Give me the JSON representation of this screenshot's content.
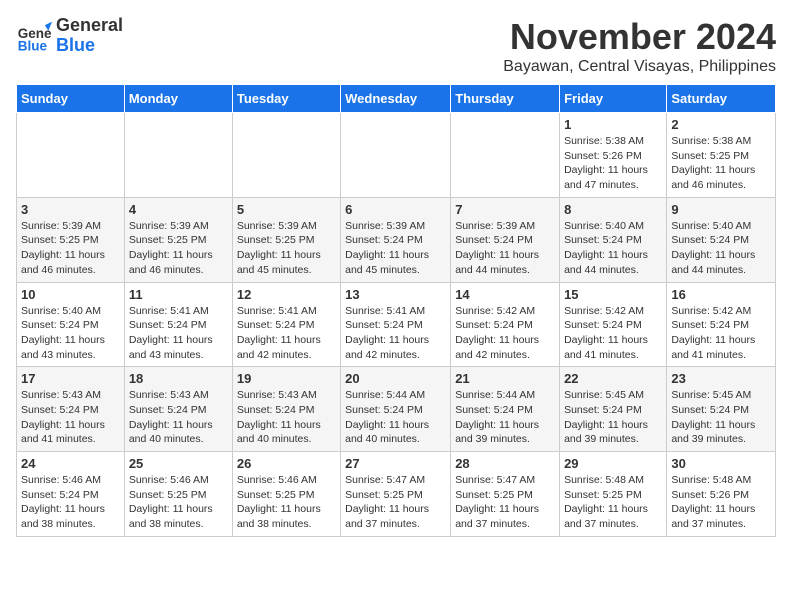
{
  "logo": {
    "line1": "General",
    "line2": "Blue"
  },
  "title": "November 2024",
  "location": "Bayawan, Central Visayas, Philippines",
  "weekdays": [
    "Sunday",
    "Monday",
    "Tuesday",
    "Wednesday",
    "Thursday",
    "Friday",
    "Saturday"
  ],
  "weeks": [
    [
      {
        "day": "",
        "info": ""
      },
      {
        "day": "",
        "info": ""
      },
      {
        "day": "",
        "info": ""
      },
      {
        "day": "",
        "info": ""
      },
      {
        "day": "",
        "info": ""
      },
      {
        "day": "1",
        "info": "Sunrise: 5:38 AM\nSunset: 5:26 PM\nDaylight: 11 hours and 47 minutes."
      },
      {
        "day": "2",
        "info": "Sunrise: 5:38 AM\nSunset: 5:25 PM\nDaylight: 11 hours and 46 minutes."
      }
    ],
    [
      {
        "day": "3",
        "info": "Sunrise: 5:39 AM\nSunset: 5:25 PM\nDaylight: 11 hours and 46 minutes."
      },
      {
        "day": "4",
        "info": "Sunrise: 5:39 AM\nSunset: 5:25 PM\nDaylight: 11 hours and 46 minutes."
      },
      {
        "day": "5",
        "info": "Sunrise: 5:39 AM\nSunset: 5:25 PM\nDaylight: 11 hours and 45 minutes."
      },
      {
        "day": "6",
        "info": "Sunrise: 5:39 AM\nSunset: 5:24 PM\nDaylight: 11 hours and 45 minutes."
      },
      {
        "day": "7",
        "info": "Sunrise: 5:39 AM\nSunset: 5:24 PM\nDaylight: 11 hours and 44 minutes."
      },
      {
        "day": "8",
        "info": "Sunrise: 5:40 AM\nSunset: 5:24 PM\nDaylight: 11 hours and 44 minutes."
      },
      {
        "day": "9",
        "info": "Sunrise: 5:40 AM\nSunset: 5:24 PM\nDaylight: 11 hours and 44 minutes."
      }
    ],
    [
      {
        "day": "10",
        "info": "Sunrise: 5:40 AM\nSunset: 5:24 PM\nDaylight: 11 hours and 43 minutes."
      },
      {
        "day": "11",
        "info": "Sunrise: 5:41 AM\nSunset: 5:24 PM\nDaylight: 11 hours and 43 minutes."
      },
      {
        "day": "12",
        "info": "Sunrise: 5:41 AM\nSunset: 5:24 PM\nDaylight: 11 hours and 42 minutes."
      },
      {
        "day": "13",
        "info": "Sunrise: 5:41 AM\nSunset: 5:24 PM\nDaylight: 11 hours and 42 minutes."
      },
      {
        "day": "14",
        "info": "Sunrise: 5:42 AM\nSunset: 5:24 PM\nDaylight: 11 hours and 42 minutes."
      },
      {
        "day": "15",
        "info": "Sunrise: 5:42 AM\nSunset: 5:24 PM\nDaylight: 11 hours and 41 minutes."
      },
      {
        "day": "16",
        "info": "Sunrise: 5:42 AM\nSunset: 5:24 PM\nDaylight: 11 hours and 41 minutes."
      }
    ],
    [
      {
        "day": "17",
        "info": "Sunrise: 5:43 AM\nSunset: 5:24 PM\nDaylight: 11 hours and 41 minutes."
      },
      {
        "day": "18",
        "info": "Sunrise: 5:43 AM\nSunset: 5:24 PM\nDaylight: 11 hours and 40 minutes."
      },
      {
        "day": "19",
        "info": "Sunrise: 5:43 AM\nSunset: 5:24 PM\nDaylight: 11 hours and 40 minutes."
      },
      {
        "day": "20",
        "info": "Sunrise: 5:44 AM\nSunset: 5:24 PM\nDaylight: 11 hours and 40 minutes."
      },
      {
        "day": "21",
        "info": "Sunrise: 5:44 AM\nSunset: 5:24 PM\nDaylight: 11 hours and 39 minutes."
      },
      {
        "day": "22",
        "info": "Sunrise: 5:45 AM\nSunset: 5:24 PM\nDaylight: 11 hours and 39 minutes."
      },
      {
        "day": "23",
        "info": "Sunrise: 5:45 AM\nSunset: 5:24 PM\nDaylight: 11 hours and 39 minutes."
      }
    ],
    [
      {
        "day": "24",
        "info": "Sunrise: 5:46 AM\nSunset: 5:24 PM\nDaylight: 11 hours and 38 minutes."
      },
      {
        "day": "25",
        "info": "Sunrise: 5:46 AM\nSunset: 5:25 PM\nDaylight: 11 hours and 38 minutes."
      },
      {
        "day": "26",
        "info": "Sunrise: 5:46 AM\nSunset: 5:25 PM\nDaylight: 11 hours and 38 minutes."
      },
      {
        "day": "27",
        "info": "Sunrise: 5:47 AM\nSunset: 5:25 PM\nDaylight: 11 hours and 37 minutes."
      },
      {
        "day": "28",
        "info": "Sunrise: 5:47 AM\nSunset: 5:25 PM\nDaylight: 11 hours and 37 minutes."
      },
      {
        "day": "29",
        "info": "Sunrise: 5:48 AM\nSunset: 5:25 PM\nDaylight: 11 hours and 37 minutes."
      },
      {
        "day": "30",
        "info": "Sunrise: 5:48 AM\nSunset: 5:26 PM\nDaylight: 11 hours and 37 minutes."
      }
    ]
  ]
}
